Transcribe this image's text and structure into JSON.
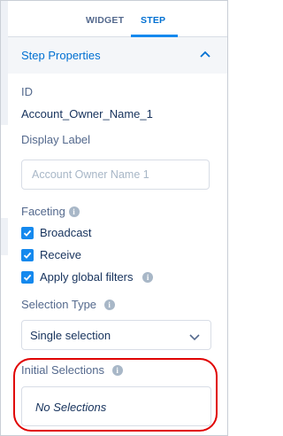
{
  "tabs": [
    {
      "label": "WIDGET",
      "active": false
    },
    {
      "label": "STEP",
      "active": true
    }
  ],
  "section": {
    "title": "Step Properties",
    "expanded": true
  },
  "id_field": {
    "label": "ID",
    "value": "Account_Owner_Name_1"
  },
  "display_label": {
    "label": "Display Label",
    "placeholder": "Account Owner Name 1"
  },
  "faceting": {
    "label": "Faceting",
    "options": [
      {
        "label": "Broadcast",
        "checked": true
      },
      {
        "label": "Receive",
        "checked": true
      },
      {
        "label": "Apply global filters",
        "checked": true,
        "has_info": true
      }
    ]
  },
  "selection_type": {
    "label": "Selection Type",
    "value": "Single selection"
  },
  "initial_selections": {
    "label": "Initial Selections",
    "value": "No Selections"
  },
  "colors": {
    "accent": "#0070d2",
    "checkbox": "#1589ee",
    "highlight": "#e00000"
  },
  "icons": {
    "info": "info-icon",
    "collapse": "chevron-up-icon",
    "dropdown": "chevron-down-icon"
  }
}
